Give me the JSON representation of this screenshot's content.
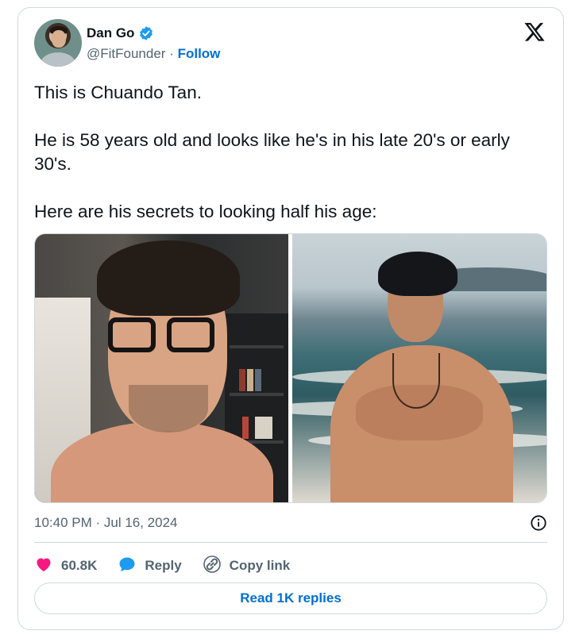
{
  "author": {
    "name": "Dan Go",
    "handle": "@FitFounder",
    "separator": " · ",
    "follow_label": "Follow",
    "verified_icon": "verified-badge-icon"
  },
  "brand_icon": "x-logo-icon",
  "tweet": {
    "text": "This is Chuando Tan.\n\nHe is 58 years old and looks like he's in his late 20's or early 30's.\n\nHere are his secrets to looking half his age:"
  },
  "media": [
    {
      "alt": "Selfie of a man with dark hair and black glasses in front of a bookshelf"
    },
    {
      "alt": "Shirtless man with dark hair and a necklace at the sea"
    }
  ],
  "timestamp": "10:40 PM · Jul 16, 2024",
  "actions": {
    "like_count": "60.8K",
    "reply_label": "Reply",
    "copy_link_label": "Copy link"
  },
  "read_replies_label": "Read 1K replies",
  "colors": {
    "accent": "#006fd6",
    "like": "#f91880",
    "reply": "#1d9bf0",
    "muted": "#536471",
    "border": "#cfd9de"
  }
}
